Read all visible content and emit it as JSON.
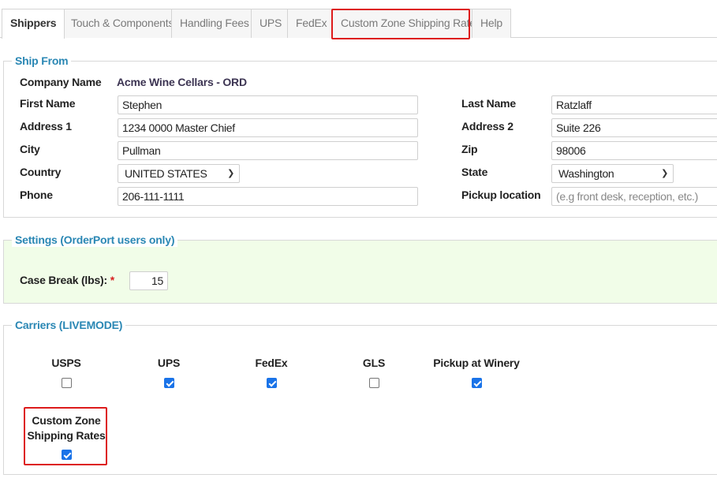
{
  "tabs": [
    {
      "label": "Shippers",
      "active": true
    },
    {
      "label": "Touch & Components",
      "active": false
    },
    {
      "label": "Handling Fees",
      "active": false
    },
    {
      "label": "UPS",
      "active": false
    },
    {
      "label": "FedEx",
      "active": false
    },
    {
      "label": "Custom Zone Shipping Rates",
      "active": false,
      "highlighted": true
    },
    {
      "label": "Help",
      "active": false
    }
  ],
  "ship_from": {
    "legend": "Ship From",
    "company_name_label": "Company Name",
    "company_name": "Acme Wine Cellars - ORD",
    "first_name_label": "First Name",
    "first_name": "Stephen",
    "last_name_label": "Last Name",
    "last_name": "Ratzlaff",
    "address1_label": "Address 1",
    "address1": "1234 0000 Master Chief",
    "address2_label": "Address 2",
    "address2": "Suite 226",
    "city_label": "City",
    "city": "Pullman",
    "zip_label": "Zip",
    "zip": "98006",
    "country_label": "Country",
    "country": "UNITED STATES",
    "state_label": "State",
    "state": "Washington",
    "phone_label": "Phone",
    "phone": "206-111-1111",
    "pickup_label": "Pickup location",
    "pickup_placeholder": "(e.g front desk, reception, etc.)"
  },
  "settings": {
    "legend": "Settings (OrderPort users only)",
    "case_break_label": "Case Break (lbs):",
    "required_mark": "*",
    "case_break": "15"
  },
  "carriers": {
    "legend": "Carriers (LIVEMODE)",
    "items": [
      {
        "label": "USPS",
        "checked": false
      },
      {
        "label": "UPS",
        "checked": true
      },
      {
        "label": "FedEx",
        "checked": true
      },
      {
        "label": "GLS",
        "checked": false
      },
      {
        "label": "Pickup at Winery",
        "checked": true
      }
    ],
    "custom_zone_line1": "Custom Zone",
    "custom_zone_line2": "Shipping Rates",
    "custom_zone_checked": true
  },
  "colors": {
    "legend": "#2a87b4",
    "highlight": "#dd1b1b",
    "settings_bg": "#f1fde8",
    "checkbox": "#1a73e8"
  }
}
